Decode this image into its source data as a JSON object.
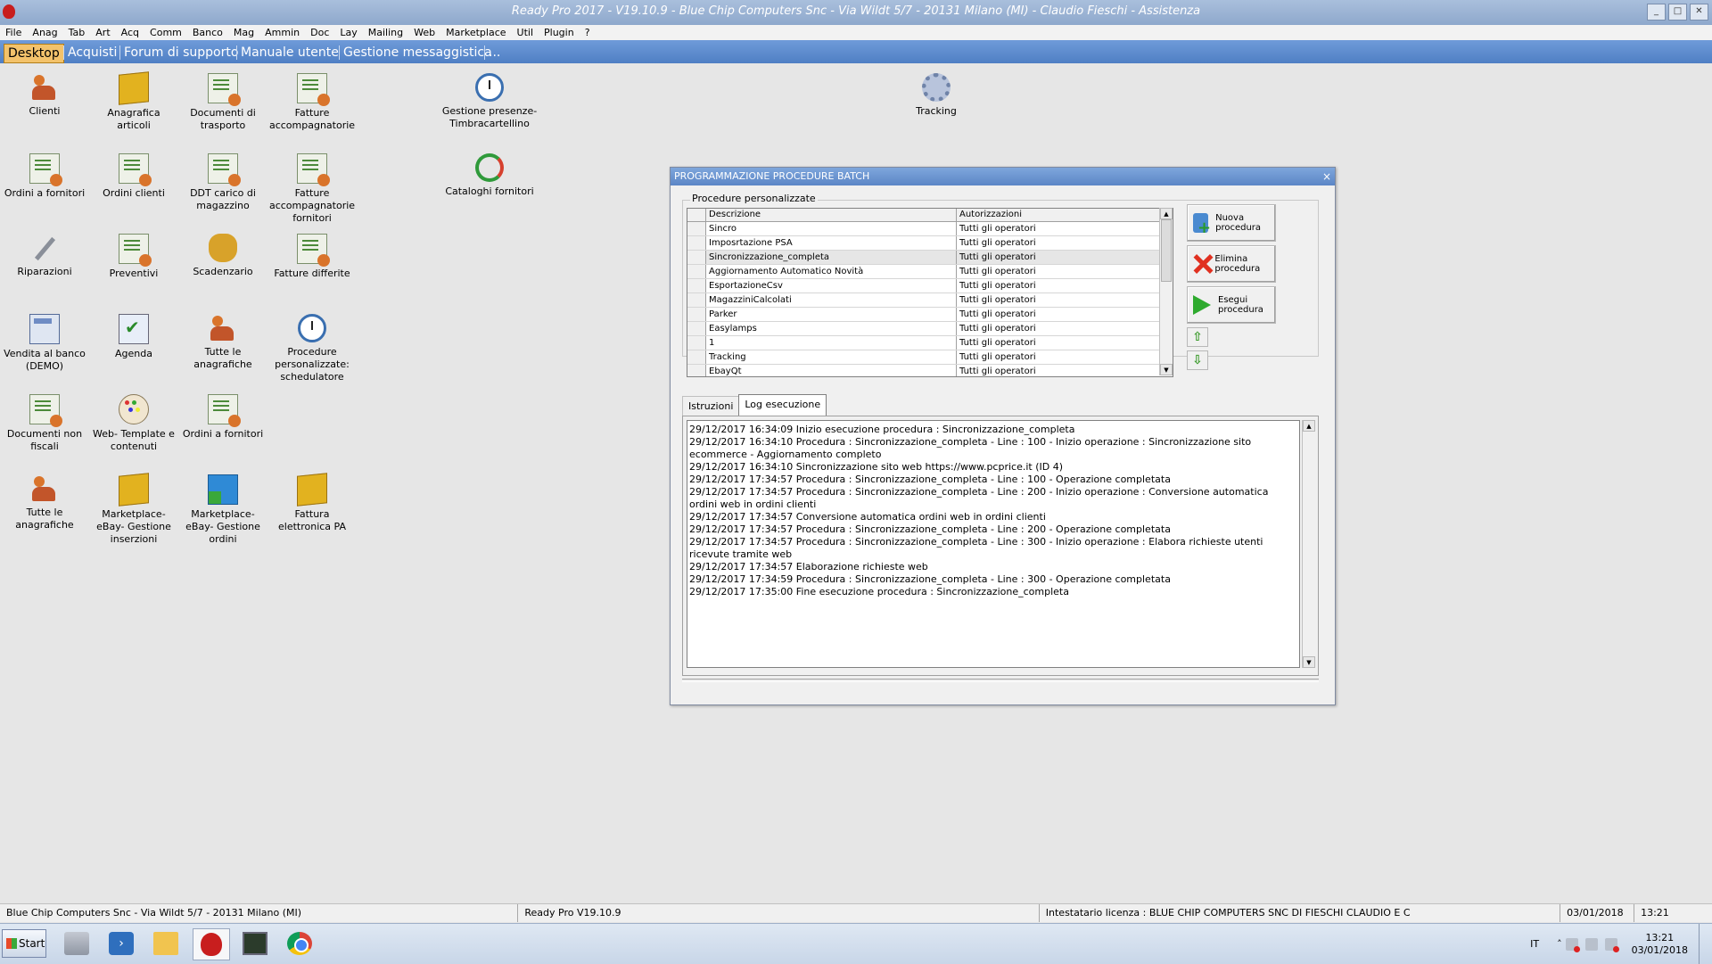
{
  "window": {
    "title": "Ready Pro 2017 - V19.10.9 - Blue Chip Computers Snc - Via Wildt 5/7 - 20131 Milano (MI) - Claudio Fieschi - Assistenza"
  },
  "menu": [
    "File",
    "Anag",
    "Tab",
    "Art",
    "Acq",
    "Comm",
    "Banco",
    "Mag",
    "Ammin",
    "Doc",
    "Lay",
    "Mailing",
    "Web",
    "Marketplace",
    "Util",
    "Plugin",
    "?"
  ],
  "tabs": [
    "Desktop",
    "Acquisti",
    "Forum di supporto",
    "Manuale utente",
    "Gestione messaggistica",
    "..."
  ],
  "desktop_icons": [
    {
      "label": "Clienti",
      "icon": "clients-icon"
    },
    {
      "label": "Anagrafica articoli",
      "icon": "articles-box-icon"
    },
    {
      "label": "Documenti di trasporto",
      "icon": "transport-documents-icon"
    },
    {
      "label": "Fatture accompagnatorie",
      "icon": "invoices-icon"
    },
    {
      "label": "Gestione presenze-Timbracartellino",
      "icon": "attendance-clock-icon"
    },
    {
      "label": "Tracking",
      "icon": "tracking-gear-icon"
    },
    {
      "label": "Ordini a fornitori",
      "icon": "supplier-orders-icon"
    },
    {
      "label": "Ordini clienti",
      "icon": "customer-orders-icon"
    },
    {
      "label": "DDT carico di magazzino",
      "icon": "warehouse-ddt-icon"
    },
    {
      "label": "Fatture accompagnatorie fornitori",
      "icon": "supplier-invoices-icon"
    },
    {
      "label": "Cataloghi fornitori",
      "icon": "supplier-catalogs-icon"
    },
    {
      "label": "Riparazioni",
      "icon": "repairs-wrench-icon"
    },
    {
      "label": "Preventivi",
      "icon": "quotes-icon"
    },
    {
      "label": "Scadenzario",
      "icon": "deadlines-bag-icon"
    },
    {
      "label": "Fatture differite",
      "icon": "deferred-invoices-icon"
    },
    {
      "label": "Vendita al banco (DEMO)",
      "icon": "pos-sale-icon"
    },
    {
      "label": "Agenda",
      "icon": "agenda-icon"
    },
    {
      "label": "Tutte le anagrafiche",
      "icon": "all-registries-icon"
    },
    {
      "label": "Procedure personalizzate: schedulatore",
      "icon": "scheduler-clock-icon"
    },
    {
      "label": "Documenti non fiscali",
      "icon": "non-fiscal-documents-icon"
    },
    {
      "label": "Web- Template e contenuti",
      "icon": "web-template-icon"
    },
    {
      "label": "Ordini a fornitori",
      "icon": "supplier-orders-icon"
    },
    {
      "label": "Tutte le anagrafiche",
      "icon": "all-registries-icon"
    },
    {
      "label": "Marketplace- eBay- Gestione inserzioni",
      "icon": "ebay-listings-icon"
    },
    {
      "label": "Marketplace- eBay- Gestione ordini",
      "icon": "ebay-orders-icon"
    },
    {
      "label": "Fattura elettronica PA",
      "icon": "e-invoice-icon"
    }
  ],
  "dialog": {
    "title": "PROGRAMMAZIONE PROCEDURE BATCH",
    "close": "×",
    "group_label": "Procedure personalizzate",
    "columns": [
      "Descrizione",
      "Autorizzazioni"
    ],
    "rows": [
      {
        "desc": "Sincro",
        "auth": "Tutti gli operatori"
      },
      {
        "desc": "Imposrtazione PSA",
        "auth": "Tutti gli operatori"
      },
      {
        "desc": "Sincronizzazione_completa",
        "auth": "Tutti gli operatori"
      },
      {
        "desc": "Aggiornamento Automatico Novità",
        "auth": "Tutti gli operatori"
      },
      {
        "desc": "EsportazioneCsv",
        "auth": "Tutti gli operatori"
      },
      {
        "desc": "MagazziniCalcolati",
        "auth": "Tutti gli operatori"
      },
      {
        "desc": "Parker",
        "auth": "Tutti gli operatori"
      },
      {
        "desc": "Easylamps",
        "auth": "Tutti gli operatori"
      },
      {
        "desc": "1",
        "auth": "Tutti gli operatori"
      },
      {
        "desc": "Tracking",
        "auth": "Tutti gli operatori"
      },
      {
        "desc": "EbayQt",
        "auth": "Tutti gli operatori"
      }
    ],
    "selected_row": "Sincronizzazione_completa",
    "buttons": {
      "new": "Nuova procedura",
      "delete": "Elimina procedura",
      "run": "Esegui procedura"
    },
    "inner_tabs": [
      "Istruzioni",
      "Log esecuzione"
    ],
    "active_inner_tab": "Log esecuzione",
    "log": [
      "29/12/2017 16:34:09 Inizio esecuzione procedura : Sincronizzazione_completa",
      "29/12/2017 16:34:10 Procedura : Sincronizzazione_completa - Line : 100 - Inizio operazione : Sincronizzazione sito ecommerce - Aggiornamento completo",
      "29/12/2017 16:34:10 Sincronizzazione sito web https://www.pcprice.it (ID 4)",
      "29/12/2017 17:34:57 Procedura : Sincronizzazione_completa - Line : 100 - Operazione completata",
      "29/12/2017 17:34:57 Procedura : Sincronizzazione_completa - Line : 200 - Inizio operazione : Conversione automatica ordini web in ordini clienti",
      "29/12/2017 17:34:57 Conversione automatica ordini web in ordini clienti",
      "29/12/2017 17:34:57 Procedura : Sincronizzazione_completa - Line : 200 - Operazione completata",
      "29/12/2017 17:34:57 Procedura : Sincronizzazione_completa - Line : 300 - Inizio operazione : Elabora richieste utenti ricevute tramite web",
      "29/12/2017 17:34:57 Elaborazione richieste web",
      "29/12/2017 17:34:59 Procedura : Sincronizzazione_completa - Line : 300 - Operazione completata",
      "29/12/2017 17:35:00 Fine esecuzione procedura : Sincronizzazione_completa"
    ]
  },
  "statusbar": {
    "company": "Blue Chip Computers Snc - Via Wildt 5/7 - 20131 Milano (MI)",
    "version": "Ready Pro V19.10.9",
    "license": "Intestatario licenza : BLUE CHIP COMPUTERS SNC DI FIESCHI CLAUDIO E C",
    "date": "03/01/2018",
    "time": "13:21"
  },
  "taskbar": {
    "start": "Start",
    "apps": [
      "server-manager-icon",
      "powershell-icon",
      "file-explorer-icon",
      "ready-pro-icon",
      "remote-desktop-icon",
      "chrome-icon"
    ],
    "lang": "IT",
    "clock_time": "13:21",
    "clock_date": "03/01/2018"
  },
  "colors": {
    "titlebar": "#8ea8cc",
    "tabbar": "#4f7fc4",
    "active_tab": "#f3c26b",
    "dialog_title": "#5c86c6"
  }
}
